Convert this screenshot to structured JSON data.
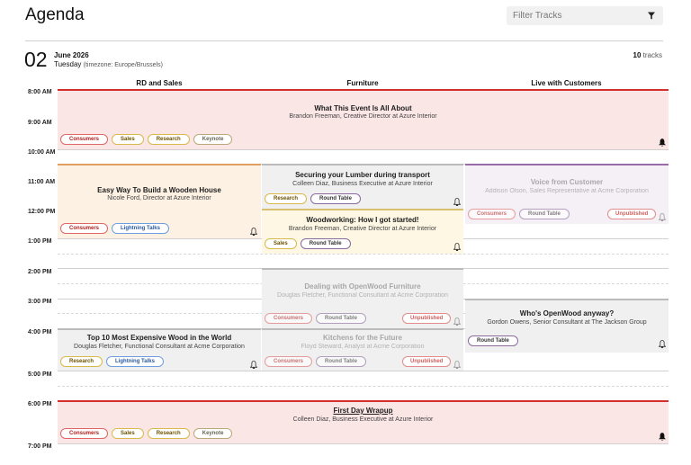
{
  "header": {
    "title": "Agenda",
    "filter_placeholder": "Filter Tracks"
  },
  "date": {
    "day": "02",
    "month_year": "June 2026",
    "weekday": "Tuesday",
    "timezone": "(timezone: Europe/Brussels)",
    "track_count": "10",
    "track_label": "tracks"
  },
  "columns": [
    "RD and Sales",
    "Furniture",
    "Live with Customers"
  ],
  "times": [
    "8:00 AM",
    "9:00 AM",
    "10:00 AM",
    "11:00 AM",
    "12:00 PM",
    "1:00 PM",
    "2:00 PM",
    "3:00 PM",
    "4:00 PM",
    "5:00 PM",
    "6:00 PM",
    "7:00 PM"
  ],
  "events": {
    "e1": {
      "title": "What This Event Is All About",
      "speaker": "Brandon Freeman, Creative Director at Azure Interior",
      "tags": [
        "Consumers",
        "Sales",
        "Research",
        "Keynote"
      ]
    },
    "e2": {
      "title": "Easy Way To Build a Wooden House",
      "speaker": "Nicole Ford, Director at Azure Interior",
      "tags": [
        "Consumers",
        "Lightning Talks"
      ]
    },
    "e3": {
      "title": "Securing your Lumber during transport",
      "speaker": "Colleen Diaz, Business Executive at Azure Interior",
      "tags": [
        "Research",
        "Round Table"
      ]
    },
    "e4": {
      "title": "Voice from Customer",
      "speaker": "Addison Olson, Sales Representative at Acme Corporation",
      "tags": [
        "Consumers",
        "Round Table"
      ],
      "status": "Unpublished"
    },
    "e5": {
      "title": "Woodworking: How I got started!",
      "speaker": "Brandon Freeman, Creative Director at Azure Interior",
      "tags": [
        "Sales",
        "Round Table"
      ]
    },
    "e6": {
      "title": "Dealing with OpenWood Furniture",
      "speaker": "Douglas Fletcher, Functional Consultant at Acme Corporation",
      "tags": [
        "Consumers",
        "Round Table"
      ],
      "status": "Unpublished"
    },
    "e7": {
      "title": "Who's OpenWood anyway?",
      "speaker": "Gordon Owens, Senior Consultant at The Jackson Group",
      "tags": [
        "Round Table"
      ]
    },
    "e8": {
      "title": "Top 10 Most Expensive Wood in the World",
      "speaker": "Douglas Fletcher, Functional Consultant at Acme Corporation",
      "tags": [
        "Research",
        "Lightning Talks"
      ]
    },
    "e9": {
      "title": "Kitchens for the Future",
      "speaker": "Floyd Steward, Analyst at Acme Corporation",
      "tags": [
        "Consumers",
        "Round Table"
      ],
      "status": "Unpublished"
    },
    "e10": {
      "title": "First Day Wrapup",
      "speaker": "Colleen Diaz, Business Executive at Azure Interior",
      "tags": [
        "Consumers",
        "Sales",
        "Research",
        "Keynote"
      ]
    }
  },
  "colors": {
    "keynote_bg": "#fbe6e6",
    "keynote_border": "#d32f2f",
    "talk_bg": "#fdf1e4",
    "talk_border": "#e0a060",
    "furniture_bg": "#f0f0f0",
    "woodworking_bg": "#fdf7e3",
    "woodworking_border": "#d8c070",
    "customer_bg": "#f5f0f5",
    "customer_border": "#9a6ba8"
  }
}
